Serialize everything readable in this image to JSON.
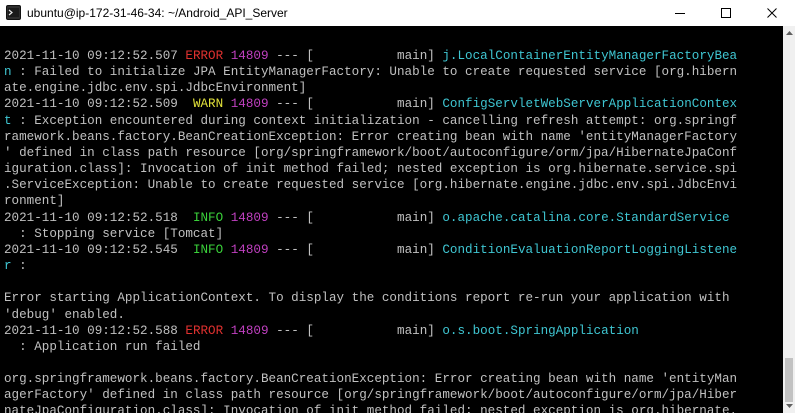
{
  "window": {
    "title": "ubuntu@ip-172-31-46-34: ~/Android_API_Server",
    "minimize_icon": "minimize-icon",
    "maximize_icon": "maximize-icon",
    "close_icon": "close-icon"
  },
  "colors": {
    "background": "#000000",
    "text": "#c0c0c0",
    "error": "#e0312f",
    "warn": "#e2e23a",
    "info": "#3ad13a",
    "pid": "#c040c0",
    "logger": "#3fc6d2"
  },
  "log": {
    "e1": {
      "ts": "2021-11-10 09:12:52.507",
      "level": " ERROR",
      "pid": " 14809",
      "sep": " --- [           main] ",
      "logger": "j.LocalContainerEntityManagerFactoryBea",
      "cont": "n",
      "msg": " : Failed to initialize JPA EntityManagerFactory: Unable to create requested service [org.hibern\nate.engine.jdbc.env.spi.JdbcEnvironment]"
    },
    "e2": {
      "ts": "2021-11-10 09:12:52.509",
      "level": "  WARN",
      "pid": " 14809",
      "sep": " --- [           main] ",
      "logger": "ConfigServletWebServerApplicationContex",
      "cont": "t",
      "msg": " : Exception encountered during context initialization - cancelling refresh attempt: org.springf\nramework.beans.factory.BeanCreationException: Error creating bean with name 'entityManagerFactory\n' defined in class path resource [org/springframework/boot/autoconfigure/orm/jpa/HibernateJpaConf\niguration.class]: Invocation of init method failed; nested exception is org.hibernate.service.spi\n.ServiceException: Unable to create requested service [org.hibernate.engine.jdbc.env.spi.JdbcEnvi\nronment]"
    },
    "e3": {
      "ts": "2021-11-10 09:12:52.518",
      "level": "  INFO",
      "pid": " 14809",
      "sep": " --- [           main] ",
      "logger": "o.apache.catalina.core.StandardService",
      "msg": "  : Stopping service [Tomcat]"
    },
    "e4": {
      "ts": "2021-11-10 09:12:52.545",
      "level": "  INFO",
      "pid": " 14809",
      "sep": " --- [           main] ",
      "logger": "ConditionEvaluationReportLoggingListene",
      "cont": "r",
      "msg": " :"
    },
    "plain1": "\n\nError starting ApplicationContext. To display the conditions report re-run your application with\n'debug' enabled.",
    "e5": {
      "ts": "2021-11-10 09:12:52.588",
      "level": " ERROR",
      "pid": " 14809",
      "sep": " --- [           main] ",
      "logger": "o.s.boot.SpringApplication",
      "msg": "  : Application run failed"
    },
    "plain2": "\n\norg.springframework.beans.factory.BeanCreationException: Error creating bean with name 'entityMan\nagerFactory' defined in class path resource [org/springframework/boot/autoconfigure/orm/jpa/Hiber\nnateJpaConfiguration.class]: Invocation of init method failed; nested exception is org.hibernate."
  }
}
